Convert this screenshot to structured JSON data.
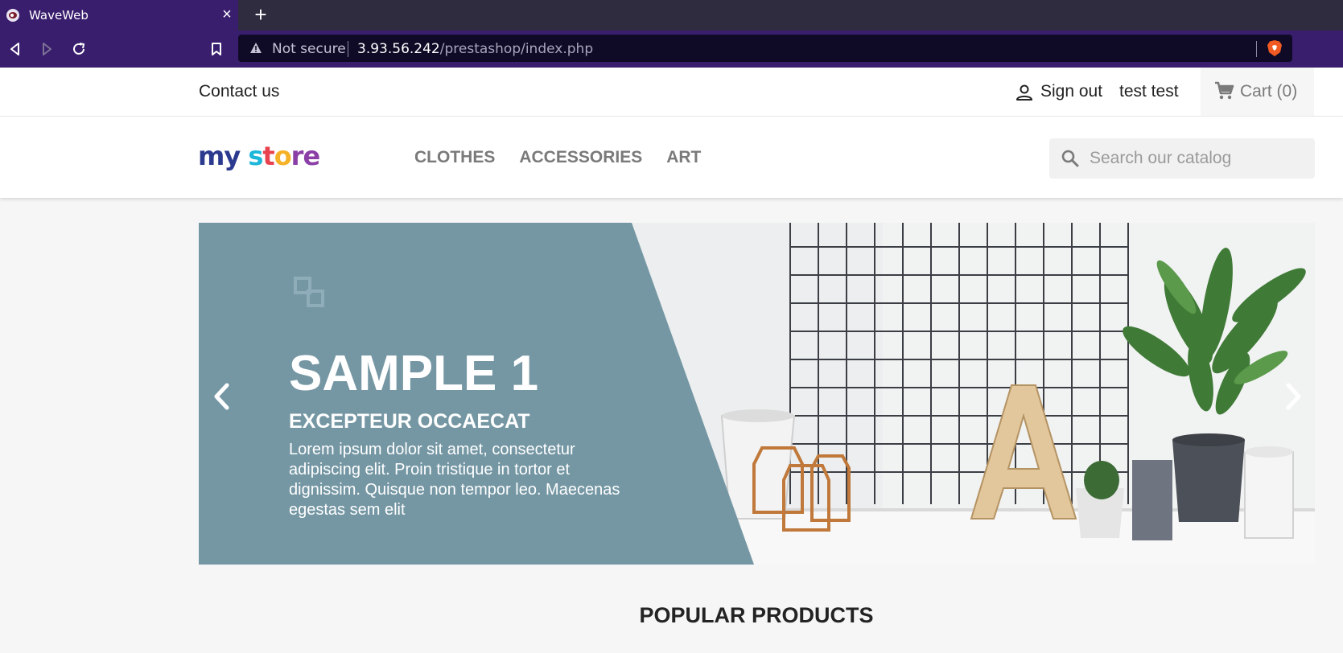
{
  "browser": {
    "tab_title": "WaveWeb",
    "close_glyph": "×",
    "new_tab_glyph": "+",
    "security_label": "Not secure",
    "url_host": "3.93.56.242",
    "url_path": "/prestashop/index.php"
  },
  "header": {
    "contact_label": "Contact us",
    "signout_label": "Sign out",
    "username": "test test",
    "cart_label": "Cart",
    "cart_count": "(0)"
  },
  "logo": {
    "part1": "my",
    "part2": "s",
    "part3": "t",
    "part4": "o",
    "part5": "re"
  },
  "menu": {
    "items": [
      "Clothes",
      "Accessories",
      "Art"
    ]
  },
  "search": {
    "placeholder": "Search our catalog",
    "value": ""
  },
  "slider": {
    "title": "SAMPLE 1",
    "subtitle": "EXCEPTEUR OCCAECAT",
    "text": "Lorem ipsum dolor sit amet, consectetur adipiscing elit. Proin tristique in tortor et dignissim. Quisque non tempor leo. Maecenas egestas sem elit",
    "panel_color": "#7597a4"
  },
  "sections": {
    "popular_title": "Popular Products"
  }
}
